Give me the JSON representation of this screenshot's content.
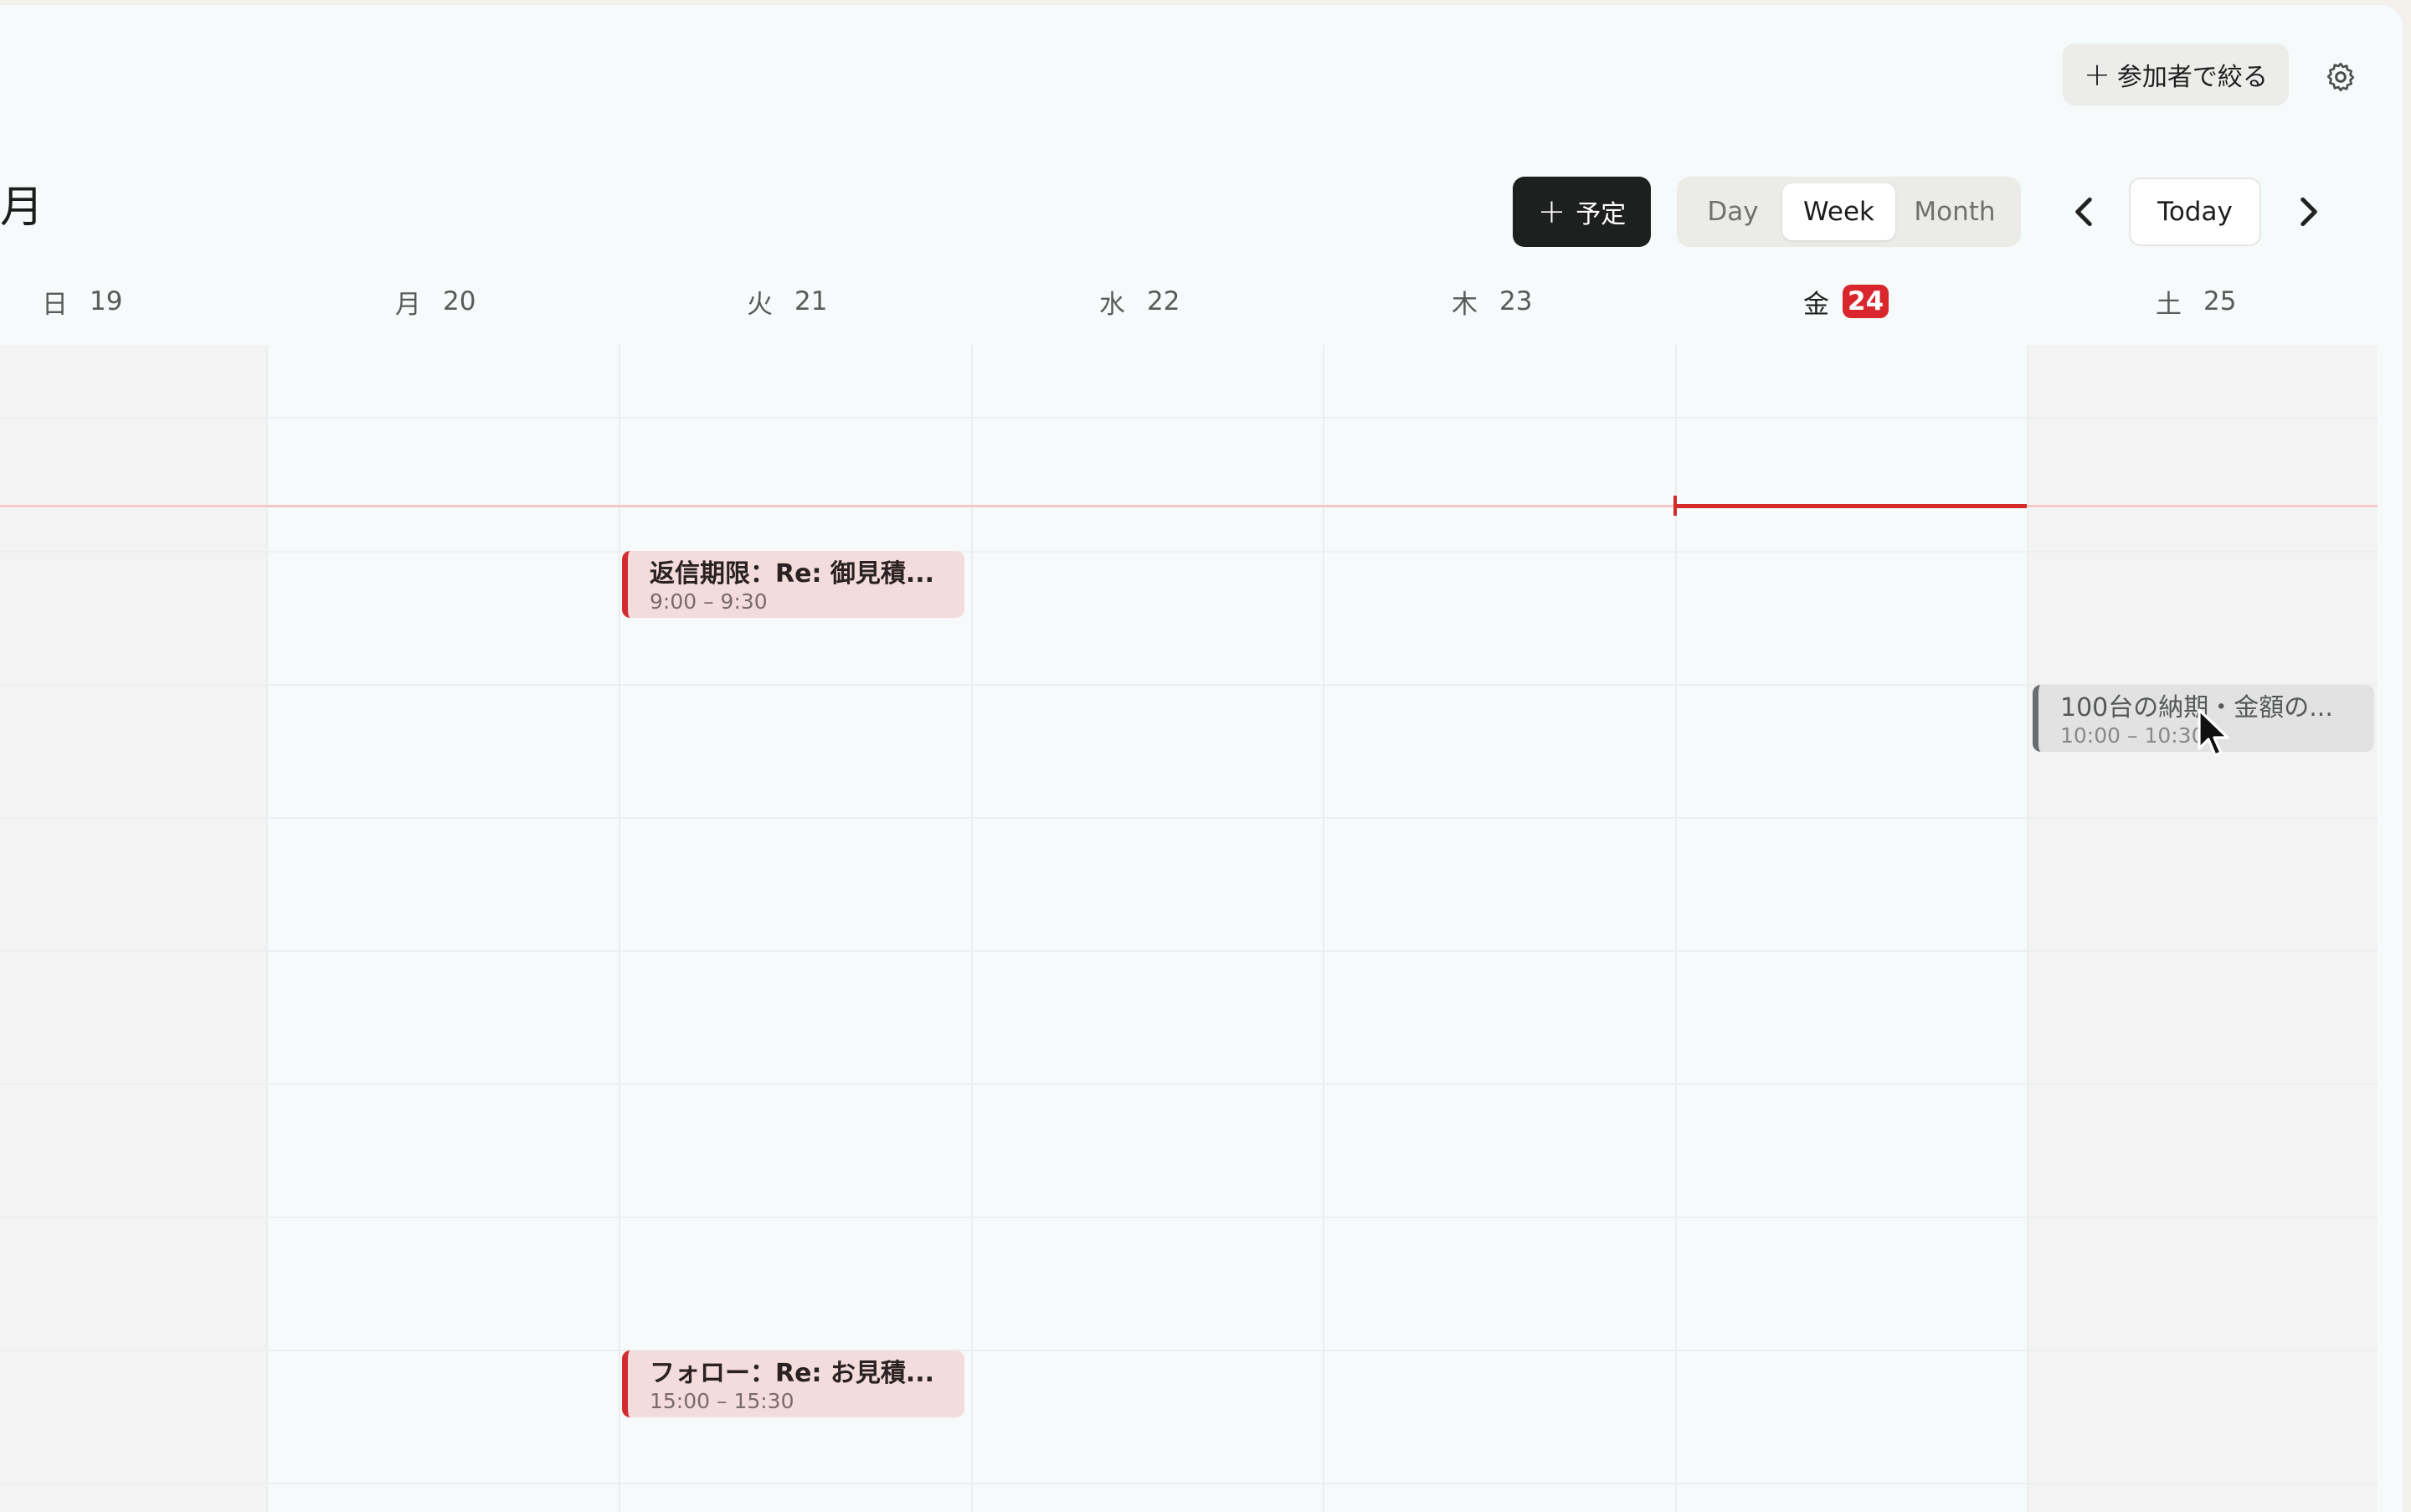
{
  "toolbar": {
    "participants_label": "参加者で絞る",
    "participants_plus": "+",
    "settings_icon": "gear-icon"
  },
  "header": {
    "month_title": "月",
    "new_event_plus": "+",
    "new_event_label": "予定",
    "views": {
      "day": "Day",
      "week": "Week",
      "month": "Month",
      "selected": "Week"
    },
    "today_label": "Today",
    "prev_icon": "chevron-left-icon",
    "next_icon": "chevron-right-icon"
  },
  "days": [
    {
      "weekday": "日",
      "date": "19"
    },
    {
      "weekday": "月",
      "date": "20"
    },
    {
      "weekday": "火",
      "date": "21"
    },
    {
      "weekday": "水",
      "date": "22"
    },
    {
      "weekday": "木",
      "date": "23"
    },
    {
      "weekday": "金",
      "date": "24",
      "today": true
    },
    {
      "weekday": "土",
      "date": "25"
    }
  ],
  "events": [
    {
      "title": "返信期限：Re: 御見積...",
      "time": "9:00 – 9:30",
      "color": "#d12c30"
    },
    {
      "title": "100台の納期・金額の...",
      "time": "10:00 – 10:30",
      "color": "#6a6d6f"
    },
    {
      "title": "フォロー：Re: お見積...",
      "time": "15:00 – 15:30",
      "color": "#d12c30"
    }
  ],
  "colors": {
    "accent_today": "#d9262c",
    "now_line": "#d22a2a"
  }
}
